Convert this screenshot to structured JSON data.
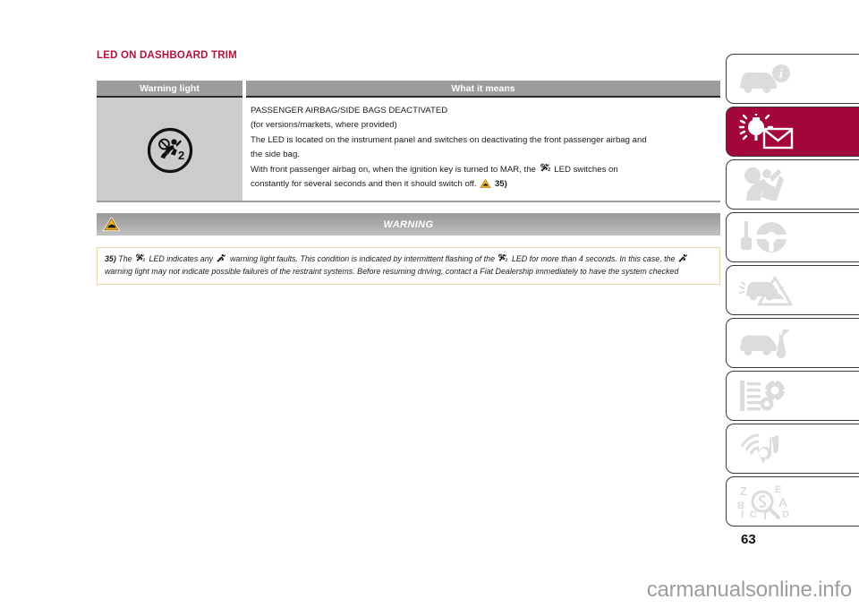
{
  "page": {
    "title": "LED ON DASHBOARD TRIM",
    "number": "63",
    "watermark": "carmanualsonline.info",
    "accent_color": "#b3123f",
    "tab_active_color": "#a3063a",
    "header_bg_color": "#9c9c9c",
    "icon_cell_bg_color": "#cccccc"
  },
  "table": {
    "headers": {
      "warning_light": "Warning light",
      "what_it_means": "What it means"
    },
    "row": {
      "icon_name": "passenger-airbag-deactivated-icon",
      "icon_label": "2",
      "lines": {
        "l1": "PASSENGER AIRBAG/SIDE BAGS DEACTIVATED",
        "l2": "(for versions/markets, where provided)",
        "l3": "The LED is located on the instrument panel and switches on deactivating the front passenger airbag and",
        "l4": "the side bag.",
        "l5a": "With front passenger airbag on, when the ignition key is turned to MAR, the",
        "l5b": "LED switches on",
        "l6a": "constantly for several seconds and then it should switch off.",
        "l6b": "35)"
      }
    }
  },
  "warning": {
    "bar_label": "WARNING",
    "bar_icon_name": "yellow-warning-triangle-icon",
    "note": {
      "ref": "35)",
      "t1": "The",
      "t2": "LED indicates any",
      "t3": "warning light faults. This condition is indicated by intermittent flashing of the",
      "t4": "LED for more than 4 seconds. In this case, the",
      "t5": "warning light may not indicate possible failures of the restraint systems. Before resuming driving, contact a Fiat Dealership immediately to have the system checked"
    }
  },
  "tabs": [
    {
      "name": "tab-dashboard-instruments",
      "icon": "car-info-icon",
      "active": false
    },
    {
      "name": "tab-warning-lights-messages",
      "icon": "lamp-envelope-icon",
      "active": true
    },
    {
      "name": "tab-safety",
      "icon": "passenger-seatbelt-icon",
      "active": false
    },
    {
      "name": "tab-starting-driving",
      "icon": "key-steering-wheel-icon",
      "active": false
    },
    {
      "name": "tab-emergency",
      "icon": "car-warning-triangle-icon",
      "active": false
    },
    {
      "name": "tab-maintenance-care",
      "icon": "car-wrench-icon",
      "active": false
    },
    {
      "name": "tab-technical-specifications",
      "icon": "list-gears-icon",
      "active": false
    },
    {
      "name": "tab-multimedia",
      "icon": "music-note-signal-icon",
      "active": false
    },
    {
      "name": "tab-alphabetical-index",
      "icon": "letters-magnifier-icon",
      "active": false
    }
  ]
}
